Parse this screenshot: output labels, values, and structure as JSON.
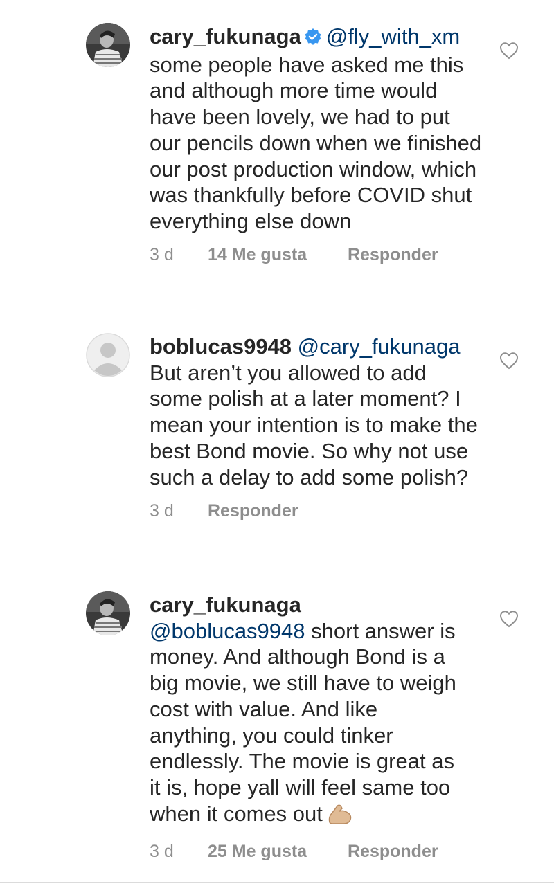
{
  "comments": [
    {
      "username": "cary_fukunaga",
      "verified": true,
      "mention": "@fly_with_xm",
      "text": "some people have asked me this and although more time would have been lovely, we had to put our pencils down when we finished our post production window, which was thankfully before COVID shut everything else down",
      "time": "3 d",
      "likes": "14 Me gusta",
      "reply": "Responder",
      "avatar": "photo"
    },
    {
      "username": "boblucas9948",
      "verified": false,
      "mention": "@cary_fukunaga",
      "text": "But aren’t you allowed to add some polish at a later moment? I mean your intention is to make the best Bond movie. So why not use such a delay to add some polish?",
      "time": "3 d",
      "likes": "",
      "reply": "Responder",
      "avatar": "default"
    },
    {
      "username": "cary_fukunaga",
      "verified": false,
      "mention": "@boblucas9948",
      "text": "short answer is money. And although Bond is a big movie, we still have to weigh cost with value. And like anything, you could tinker endlessly. The movie is great as it is, hope yall will feel same too when it comes out",
      "emoji": "flexed-biceps-icon",
      "time": "3 d",
      "likes": "25 Me gusta",
      "reply": "Responder",
      "avatar": "photo"
    }
  ],
  "colors": {
    "text": "#262626",
    "mention": "#00376b",
    "meta": "#8e8e8e",
    "verified": "#3897f0"
  },
  "icons": [
    "heart-icon",
    "verified-badge-icon",
    "default-avatar-icon"
  ]
}
